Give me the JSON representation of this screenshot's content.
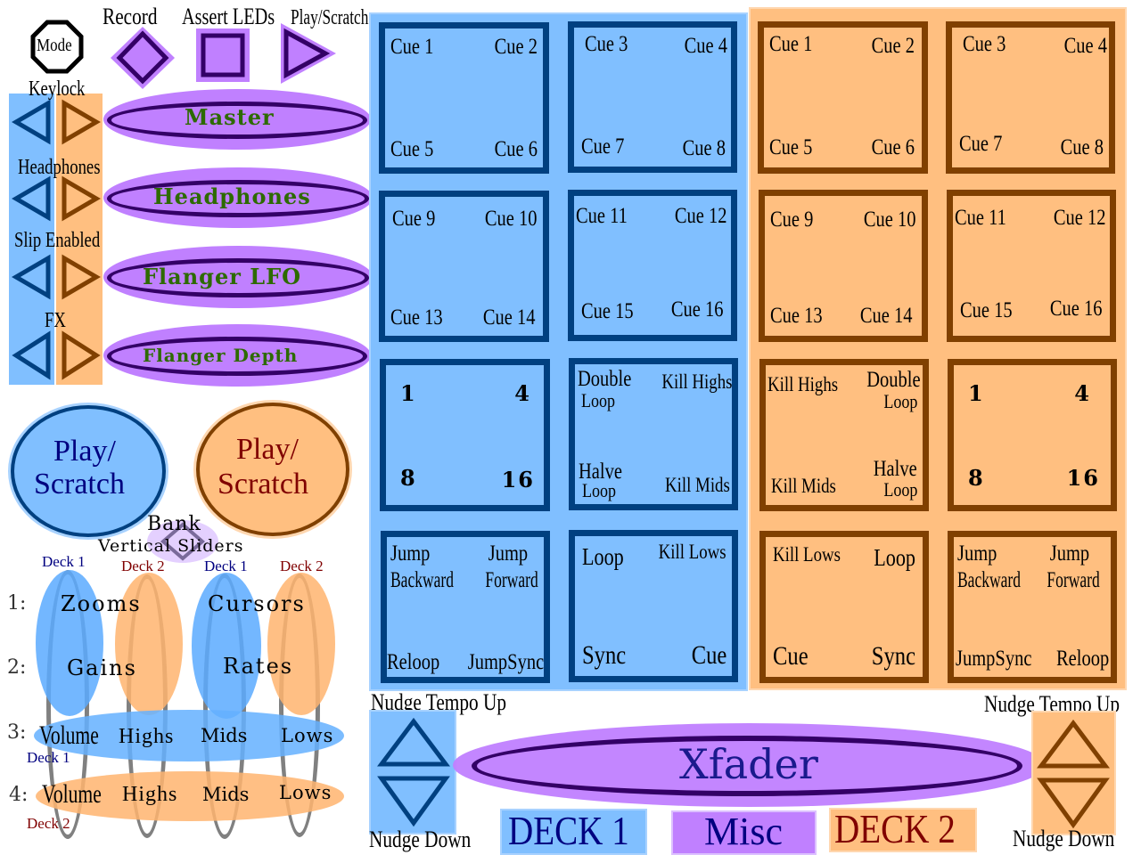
{
  "top_buttons": {
    "mode": "Mode",
    "record": "Record",
    "assert_leds": "Assert LEDs",
    "play_scratch": "Play/Scratch"
  },
  "side_buttons": [
    {
      "label": "Keylock",
      "knob": "Master"
    },
    {
      "label": "Headphones",
      "knob": "Headphones"
    },
    {
      "label": "Slip Enabled",
      "knob": "Flanger LFO"
    },
    {
      "label": "FX",
      "knob": "Flanger Depth"
    }
  ],
  "jogs": {
    "deck1": "Play/\nScratch",
    "deck1_line1": "Play/",
    "deck1_line2": "Scratch",
    "deck2_line1": "Play/",
    "deck2_line2": "Scratch"
  },
  "bank": {
    "title": "Bank",
    "subtitle": "Vertical Sliders"
  },
  "sliders": {
    "column_decks": [
      "Deck 1",
      "Deck 2",
      "Deck 1",
      "Deck 2"
    ],
    "rows": [
      {
        "num": "1:",
        "a": "Zooms",
        "b": "Cursors"
      },
      {
        "num": "2:",
        "a": "Gains",
        "b": "Rates"
      }
    ],
    "eq_rows": [
      {
        "num": "3:",
        "deck": "Deck 1",
        "items": [
          "Volume",
          "Highs",
          "Mids",
          "Lows"
        ]
      },
      {
        "num": "4:",
        "deck": "Deck 2",
        "items": [
          "Volume",
          "Highs",
          "Mids",
          "Lows"
        ]
      }
    ]
  },
  "deck1": {
    "pads": [
      {
        "tl": "Cue 1",
        "tr": "Cue 2",
        "bl": "Cue 5",
        "br": "Cue 6"
      },
      {
        "tl": "Cue 3",
        "tr": "Cue 4",
        "bl": "Cue 7",
        "br": "Cue 8"
      },
      {
        "tl": "Cue 9",
        "tr": "Cue 10",
        "bl": "Cue 13",
        "br": "Cue 14"
      },
      {
        "tl": "Cue 11",
        "tr": "Cue 12",
        "bl": "Cue 15",
        "br": "Cue 16"
      },
      {
        "tl": "1",
        "tr": "4",
        "bl": "8",
        "br": "16"
      },
      {
        "tl": "Double",
        "tl2": "Loop",
        "tr": "Kill Highs",
        "bl": "Halve",
        "bl2": "Loop",
        "br": "Kill Mids"
      },
      {
        "tl": "Jump",
        "tl2": "Backward",
        "tr": "Jump",
        "tr2": "Forward",
        "bl": "Reloop",
        "br": "JumpSync"
      },
      {
        "tl": "Loop",
        "tr": "Kill Lows",
        "bl": "Sync",
        "br": "Cue"
      }
    ],
    "nudge_up": "Nudge Tempo Up",
    "nudge_down": "Nudge Down"
  },
  "deck2": {
    "pads": [
      {
        "tl": "Cue 1",
        "tr": "Cue 2",
        "bl": "Cue 5",
        "br": "Cue 6"
      },
      {
        "tl": "Cue 3",
        "tr": "Cue 4",
        "bl": "Cue 7",
        "br": "Cue 8"
      },
      {
        "tl": "Cue 9",
        "tr": "Cue 10",
        "bl": "Cue 13",
        "br": "Cue 14"
      },
      {
        "tl": "Cue 11",
        "tr": "Cue 12",
        "bl": "Cue 15",
        "br": "Cue 16"
      },
      {
        "tl": "Kill Highs",
        "tr": "Double",
        "tr2": "Loop",
        "bl": "Kill Mids",
        "br": "Halve",
        "br2": "Loop"
      },
      {
        "tl": "1",
        "tr": "4",
        "bl": "8",
        "br": "16"
      },
      {
        "tl": "Kill Lows",
        "tr": "Loop",
        "bl": "Cue",
        "br": "Sync"
      },
      {
        "tl": "Jump",
        "tl2": "Backward",
        "tr": "Jump",
        "tr2": "Forward",
        "bl": "JumpSync",
        "br": "Reloop"
      }
    ],
    "nudge_up": "Nudge Tempo Up",
    "nudge_down": "Nudge Down"
  },
  "xfader": "Xfader",
  "legend": {
    "deck1": "DECK 1",
    "misc": "Misc",
    "deck2": "DECK 2"
  },
  "colors": {
    "deck1_fill": "#80bfff",
    "deck1_stroke": "#004080",
    "deck2_fill": "#ffbf80",
    "deck2_stroke": "#804000",
    "misc_fill": "#c080ff",
    "misc_stroke": "#330066",
    "knob_text": "#2d6a00",
    "deck1_text": "#000080",
    "deck2_text": "#800000"
  }
}
